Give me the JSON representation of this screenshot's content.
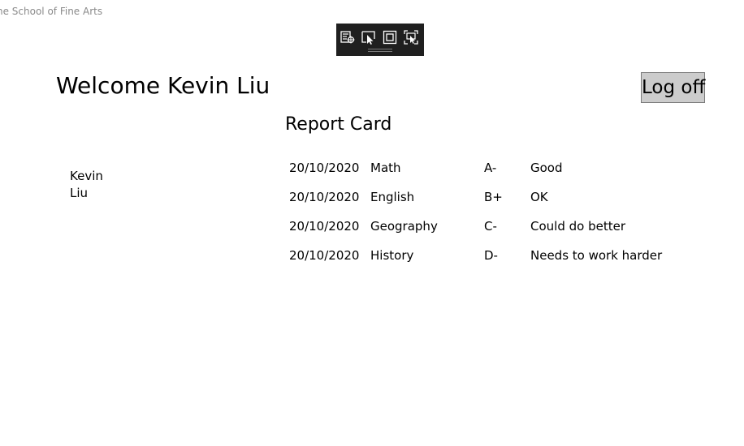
{
  "app": {
    "title": "he School of Fine Arts"
  },
  "toolbar": {
    "icons": [
      "live-visual-tree-icon",
      "select-element-icon",
      "display-layout-adorners-icon",
      "track-focused-element-icon"
    ]
  },
  "header": {
    "welcome": "Welcome Kevin Liu",
    "logoff_label": "Log off"
  },
  "report": {
    "title": "Report Card"
  },
  "student": {
    "first_name": "Kevin",
    "last_name": "Liu"
  },
  "grades": [
    {
      "date": "20/10/2020",
      "subject": "Math",
      "grade": "A-",
      "comment": "Good"
    },
    {
      "date": "20/10/2020",
      "subject": "English",
      "grade": "B+",
      "comment": "OK"
    },
    {
      "date": "20/10/2020",
      "subject": "Geography",
      "grade": "C-",
      "comment": "Could do better"
    },
    {
      "date": "20/10/2020",
      "subject": "History",
      "grade": "D-",
      "comment": "Needs to work harder"
    }
  ],
  "colors": {
    "toolbar_bg": "#1f1f1f",
    "button_bg": "#cccccc",
    "title_gray": "#8a8a8a"
  }
}
